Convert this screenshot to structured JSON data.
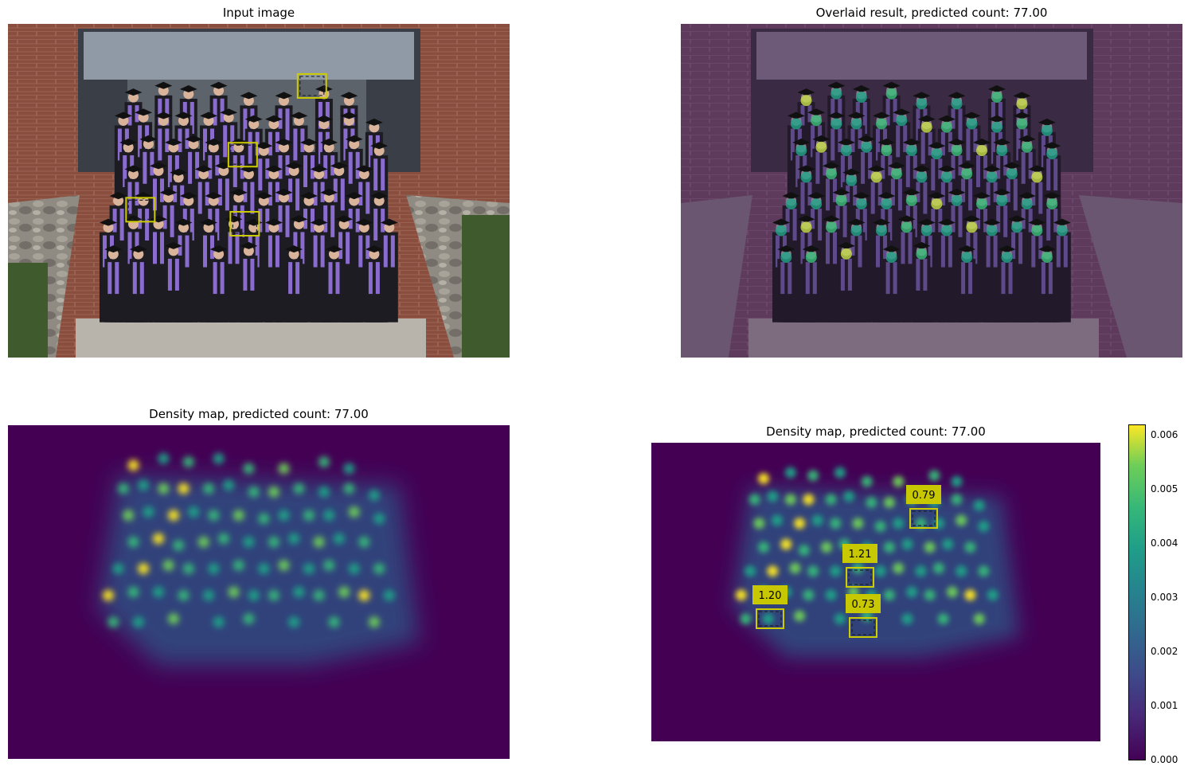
{
  "panels": {
    "input": {
      "title": "Input image"
    },
    "overlay": {
      "title": "Overlaid result, predicted count: 77.00"
    },
    "density": {
      "title": "Density map, predicted count: 77.00"
    },
    "density_boxes": {
      "title": "Density map, predicted count: 77.00"
    }
  },
  "colors": {
    "box": "#cccc00",
    "label_bg": "#c8c800",
    "map_bg": "#440154",
    "overlay_tint": "#6a3d6e"
  },
  "chart_data": {
    "type": "heatmap",
    "predicted_count": 77.0,
    "colorbar": {
      "colormap": "viridis",
      "range": [
        0.0,
        0.0062
      ],
      "ticks": [
        "0.000",
        "0.001",
        "0.002",
        "0.003",
        "0.004",
        "0.005",
        "0.006"
      ]
    },
    "exemplar_boxes": [
      {
        "label": "0.79"
      },
      {
        "label": "1.21"
      },
      {
        "label": "1.20"
      },
      {
        "label": "0.73"
      }
    ]
  }
}
